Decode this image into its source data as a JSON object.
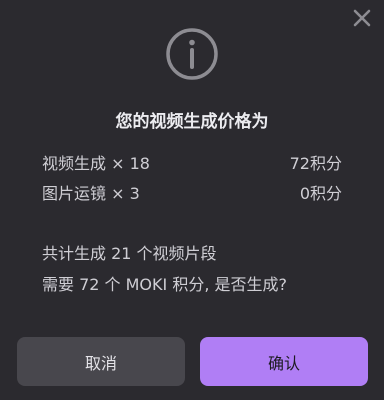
{
  "dialog": {
    "title": "您的视频生成价格为",
    "items": [
      {
        "label": "视频生成 × 18",
        "value": "72积分"
      },
      {
        "label": "图片运镜 × 3",
        "value": "0积分"
      }
    ],
    "summary_line1": "共计生成 21 个视频片段",
    "summary_line2": "需要 72 个 MOKI 积分, 是否生成?",
    "cancel_label": "取消",
    "confirm_label": "确认",
    "icons": {
      "close": "close-icon",
      "info": "info-icon"
    },
    "colors": {
      "background": "#2b2a2f",
      "accent": "#b07ef5",
      "cancel_bg": "#48474d"
    }
  }
}
